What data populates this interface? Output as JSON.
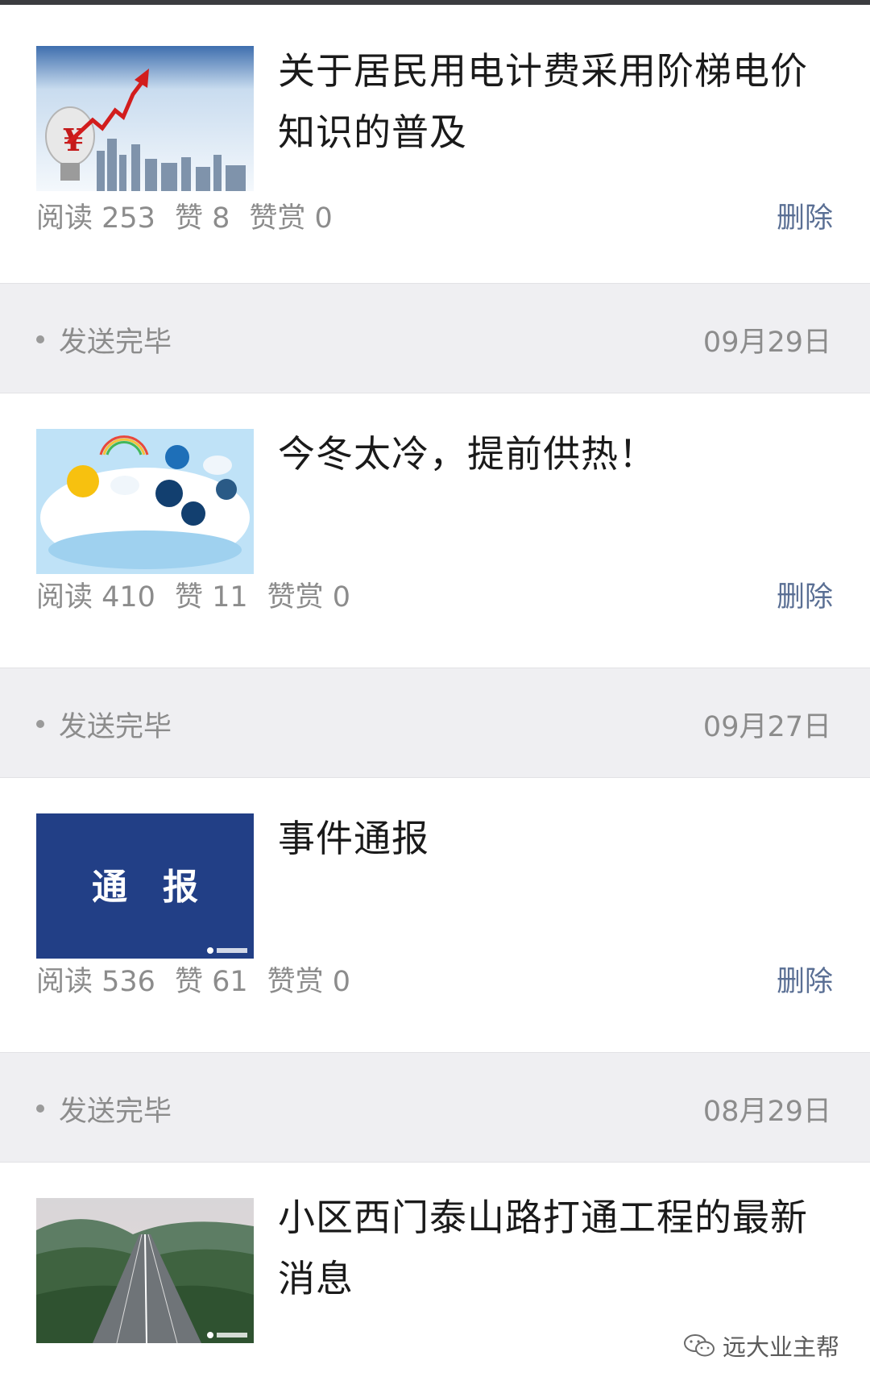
{
  "articles": [
    {
      "title": "关于居民用电计费采用阶梯电价知识的普及",
      "stats": {
        "read": "阅读 253",
        "likes": "赞 8",
        "reward": "赞赏 0"
      },
      "delete_label": "删除"
    },
    {
      "status": "发送完毕",
      "date": "09月29日",
      "title": "今冬太冷，提前供热！",
      "stats": {
        "read": "阅读 410",
        "likes": "赞 11",
        "reward": "赞赏 0"
      },
      "delete_label": "删除"
    },
    {
      "status": "发送完毕",
      "date": "09月27日",
      "title": "事件通报",
      "thumb_text": "通　报",
      "stats": {
        "read": "阅读 536",
        "likes": "赞 61",
        "reward": "赞赏 0"
      },
      "delete_label": "删除"
    },
    {
      "status": "发送完毕",
      "date": "08月29日",
      "title": "小区西门泰山路打通工程的最新消息"
    }
  ],
  "watermark": "远大业主帮",
  "colors": {
    "accent_link": "#5a6f94",
    "status_bg": "#efeff2",
    "meta_text": "#8c8c8c",
    "notice_blue": "#223f86"
  },
  "icons": [
    "electricity-price-thumbnail",
    "weather-thumbnail",
    "notice-thumbnail",
    "highway-thumbnail",
    "wechat-icon"
  ]
}
